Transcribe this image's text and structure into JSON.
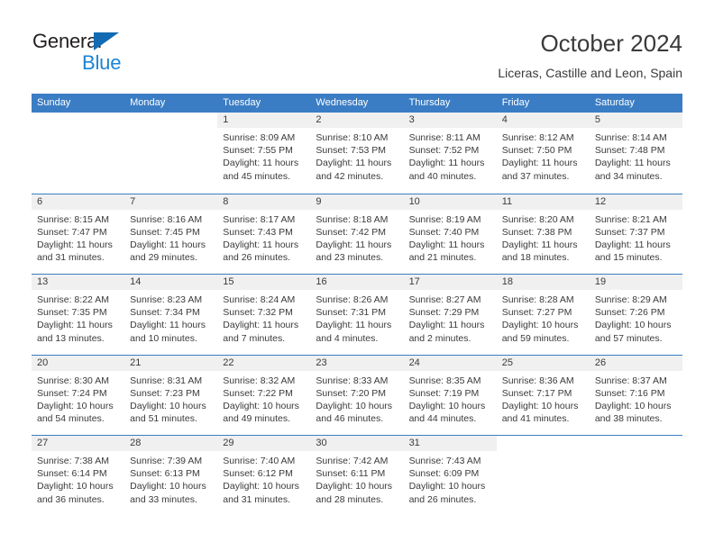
{
  "brand": {
    "name_part1": "General",
    "name_part2": "Blue",
    "triangle_color": "#136bb4",
    "blue_color": "#1b84d4"
  },
  "header": {
    "title": "October 2024",
    "location": "Liceras, Castille and Leon, Spain"
  },
  "theme": {
    "header_blue": "#3b7dc4",
    "daynum_band": "#f0f0f0",
    "text": "#3a3a3a"
  },
  "calendar": {
    "weekdays": [
      "Sunday",
      "Monday",
      "Tuesday",
      "Wednesday",
      "Thursday",
      "Friday",
      "Saturday"
    ],
    "labels": {
      "sunrise": "Sunrise:",
      "sunset": "Sunset:",
      "daylight": "Daylight:"
    },
    "weeks": [
      [
        {
          "day": "",
          "sunrise": "",
          "sunset": "",
          "daylight": ""
        },
        {
          "day": "",
          "sunrise": "",
          "sunset": "",
          "daylight": ""
        },
        {
          "day": "1",
          "sunrise": "Sunrise: 8:09 AM",
          "sunset": "Sunset: 7:55 PM",
          "daylight": "Daylight: 11 hours and 45 minutes."
        },
        {
          "day": "2",
          "sunrise": "Sunrise: 8:10 AM",
          "sunset": "Sunset: 7:53 PM",
          "daylight": "Daylight: 11 hours and 42 minutes."
        },
        {
          "day": "3",
          "sunrise": "Sunrise: 8:11 AM",
          "sunset": "Sunset: 7:52 PM",
          "daylight": "Daylight: 11 hours and 40 minutes."
        },
        {
          "day": "4",
          "sunrise": "Sunrise: 8:12 AM",
          "sunset": "Sunset: 7:50 PM",
          "daylight": "Daylight: 11 hours and 37 minutes."
        },
        {
          "day": "5",
          "sunrise": "Sunrise: 8:14 AM",
          "sunset": "Sunset: 7:48 PM",
          "daylight": "Daylight: 11 hours and 34 minutes."
        }
      ],
      [
        {
          "day": "6",
          "sunrise": "Sunrise: 8:15 AM",
          "sunset": "Sunset: 7:47 PM",
          "daylight": "Daylight: 11 hours and 31 minutes."
        },
        {
          "day": "7",
          "sunrise": "Sunrise: 8:16 AM",
          "sunset": "Sunset: 7:45 PM",
          "daylight": "Daylight: 11 hours and 29 minutes."
        },
        {
          "day": "8",
          "sunrise": "Sunrise: 8:17 AM",
          "sunset": "Sunset: 7:43 PM",
          "daylight": "Daylight: 11 hours and 26 minutes."
        },
        {
          "day": "9",
          "sunrise": "Sunrise: 8:18 AM",
          "sunset": "Sunset: 7:42 PM",
          "daylight": "Daylight: 11 hours and 23 minutes."
        },
        {
          "day": "10",
          "sunrise": "Sunrise: 8:19 AM",
          "sunset": "Sunset: 7:40 PM",
          "daylight": "Daylight: 11 hours and 21 minutes."
        },
        {
          "day": "11",
          "sunrise": "Sunrise: 8:20 AM",
          "sunset": "Sunset: 7:38 PM",
          "daylight": "Daylight: 11 hours and 18 minutes."
        },
        {
          "day": "12",
          "sunrise": "Sunrise: 8:21 AM",
          "sunset": "Sunset: 7:37 PM",
          "daylight": "Daylight: 11 hours and 15 minutes."
        }
      ],
      [
        {
          "day": "13",
          "sunrise": "Sunrise: 8:22 AM",
          "sunset": "Sunset: 7:35 PM",
          "daylight": "Daylight: 11 hours and 13 minutes."
        },
        {
          "day": "14",
          "sunrise": "Sunrise: 8:23 AM",
          "sunset": "Sunset: 7:34 PM",
          "daylight": "Daylight: 11 hours and 10 minutes."
        },
        {
          "day": "15",
          "sunrise": "Sunrise: 8:24 AM",
          "sunset": "Sunset: 7:32 PM",
          "daylight": "Daylight: 11 hours and 7 minutes."
        },
        {
          "day": "16",
          "sunrise": "Sunrise: 8:26 AM",
          "sunset": "Sunset: 7:31 PM",
          "daylight": "Daylight: 11 hours and 4 minutes."
        },
        {
          "day": "17",
          "sunrise": "Sunrise: 8:27 AM",
          "sunset": "Sunset: 7:29 PM",
          "daylight": "Daylight: 11 hours and 2 minutes."
        },
        {
          "day": "18",
          "sunrise": "Sunrise: 8:28 AM",
          "sunset": "Sunset: 7:27 PM",
          "daylight": "Daylight: 10 hours and 59 minutes."
        },
        {
          "day": "19",
          "sunrise": "Sunrise: 8:29 AM",
          "sunset": "Sunset: 7:26 PM",
          "daylight": "Daylight: 10 hours and 57 minutes."
        }
      ],
      [
        {
          "day": "20",
          "sunrise": "Sunrise: 8:30 AM",
          "sunset": "Sunset: 7:24 PM",
          "daylight": "Daylight: 10 hours and 54 minutes."
        },
        {
          "day": "21",
          "sunrise": "Sunrise: 8:31 AM",
          "sunset": "Sunset: 7:23 PM",
          "daylight": "Daylight: 10 hours and 51 minutes."
        },
        {
          "day": "22",
          "sunrise": "Sunrise: 8:32 AM",
          "sunset": "Sunset: 7:22 PM",
          "daylight": "Daylight: 10 hours and 49 minutes."
        },
        {
          "day": "23",
          "sunrise": "Sunrise: 8:33 AM",
          "sunset": "Sunset: 7:20 PM",
          "daylight": "Daylight: 10 hours and 46 minutes."
        },
        {
          "day": "24",
          "sunrise": "Sunrise: 8:35 AM",
          "sunset": "Sunset: 7:19 PM",
          "daylight": "Daylight: 10 hours and 44 minutes."
        },
        {
          "day": "25",
          "sunrise": "Sunrise: 8:36 AM",
          "sunset": "Sunset: 7:17 PM",
          "daylight": "Daylight: 10 hours and 41 minutes."
        },
        {
          "day": "26",
          "sunrise": "Sunrise: 8:37 AM",
          "sunset": "Sunset: 7:16 PM",
          "daylight": "Daylight: 10 hours and 38 minutes."
        }
      ],
      [
        {
          "day": "27",
          "sunrise": "Sunrise: 7:38 AM",
          "sunset": "Sunset: 6:14 PM",
          "daylight": "Daylight: 10 hours and 36 minutes."
        },
        {
          "day": "28",
          "sunrise": "Sunrise: 7:39 AM",
          "sunset": "Sunset: 6:13 PM",
          "daylight": "Daylight: 10 hours and 33 minutes."
        },
        {
          "day": "29",
          "sunrise": "Sunrise: 7:40 AM",
          "sunset": "Sunset: 6:12 PM",
          "daylight": "Daylight: 10 hours and 31 minutes."
        },
        {
          "day": "30",
          "sunrise": "Sunrise: 7:42 AM",
          "sunset": "Sunset: 6:11 PM",
          "daylight": "Daylight: 10 hours and 28 minutes."
        },
        {
          "day": "31",
          "sunrise": "Sunrise: 7:43 AM",
          "sunset": "Sunset: 6:09 PM",
          "daylight": "Daylight: 10 hours and 26 minutes."
        },
        {
          "day": "",
          "sunrise": "",
          "sunset": "",
          "daylight": ""
        },
        {
          "day": "",
          "sunrise": "",
          "sunset": "",
          "daylight": ""
        }
      ]
    ]
  }
}
